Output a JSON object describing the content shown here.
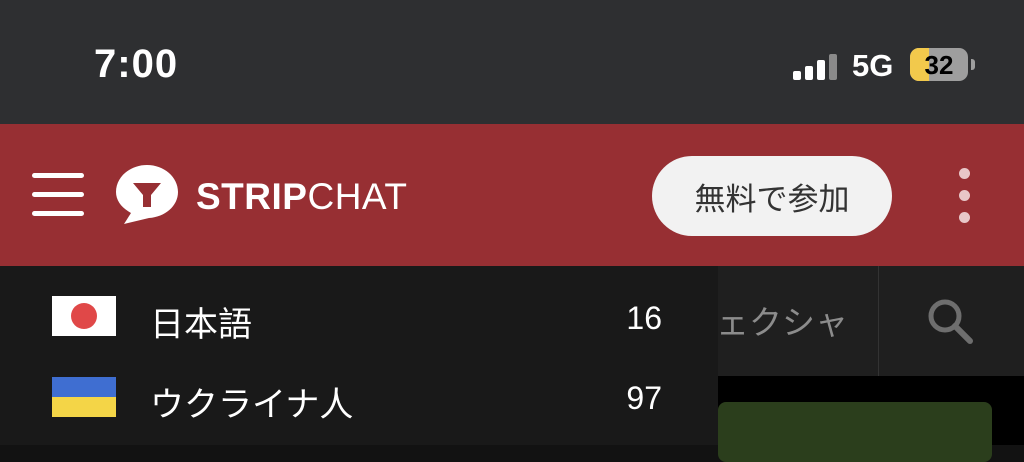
{
  "status_bar": {
    "time": "7:00",
    "network": "5G",
    "battery": "32",
    "battery_level": 0.32
  },
  "header": {
    "logo_bold": "STRIP",
    "logo_thin": "CHAT",
    "join_label": "無料で参加",
    "colors": {
      "header_bg": "#972f33",
      "button_bg": "#f2f2f2"
    }
  },
  "background": {
    "tag_text": "ェクシャ",
    "icon": "search-icon"
  },
  "languages": [
    {
      "name": "日本語",
      "count": "16",
      "flag": "japan-flag-icon"
    },
    {
      "name": "ウクライナ人",
      "count": "97",
      "flag": "ukraine-flag-icon"
    }
  ]
}
